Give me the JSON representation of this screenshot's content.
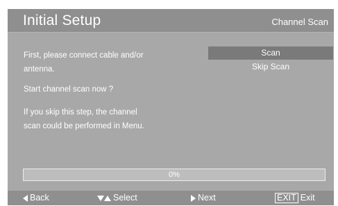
{
  "header": {
    "title": "Initial Setup",
    "subtitle": "Channel Scan"
  },
  "message": {
    "line1": "First, please connect cable and/or",
    "line2": "antenna.",
    "line3": "Start channel scan now ?",
    "line4": "If you skip this step, the channel",
    "line5": "scan could be performed in Menu."
  },
  "options": [
    {
      "label": "Scan",
      "selected": true
    },
    {
      "label": "Skip Scan",
      "selected": false
    }
  ],
  "progress": {
    "label": "0%",
    "value": 0
  },
  "footer": {
    "back": "Back",
    "select": "Select",
    "next": "Next",
    "exit_key": "EXIT",
    "exit": "Exit"
  }
}
